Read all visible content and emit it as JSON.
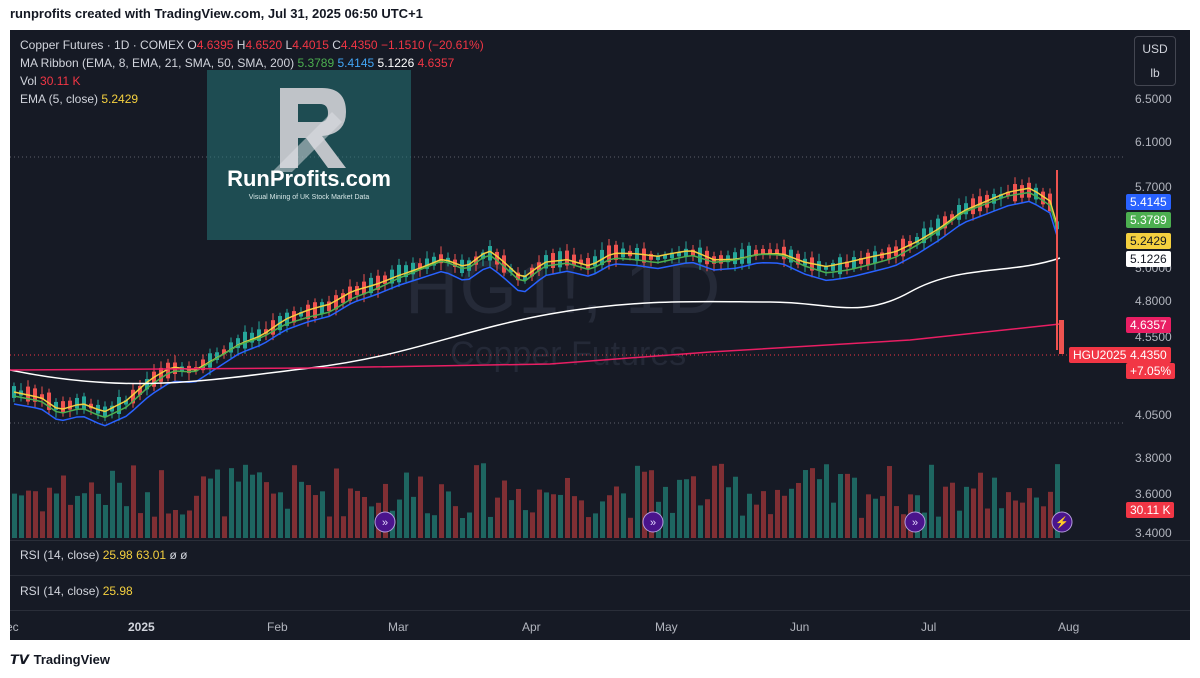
{
  "header": {
    "created_line": "runprofits created with TradingView.com, Jul 31, 2025 06:50 UTC+1"
  },
  "legend": {
    "symbol": "Copper Futures · 1D · COMEX",
    "o_label": "O",
    "o_value": "4.6395",
    "h_label": "H",
    "h_value": "4.6520",
    "l_label": "L",
    "l_value": "4.4015",
    "c_label": "C",
    "c_value": "4.4350",
    "change": "−1.1510 (−20.61%)",
    "ribbon_label": "MA Ribbon (EMA, 8, EMA, 21, SMA, 50, SMA, 200)",
    "ribbon_v1": "5.3789",
    "ribbon_v2": "5.4145",
    "ribbon_v3": "5.1226",
    "ribbon_v4": "4.6357",
    "vol_label": "Vol",
    "vol_value": "30.11 K",
    "ema_label": "EMA (5, close)",
    "ema_value": "5.2429"
  },
  "watermark": {
    "symbol": "HG1!, 1D",
    "name": "Copper Futures"
  },
  "logo": {
    "name": "RunProfits.com",
    "tagline": "Visual Mining of UK Stock Market Data"
  },
  "currency": {
    "code": "USD",
    "unit": "lb"
  },
  "price_axis": {
    "ticks": [
      "6.5000",
      "6.1000",
      "5.7000",
      "5.0000",
      "4.8000",
      "4.5500",
      "4.0500",
      "3.8000",
      "3.6000",
      "3.4000"
    ]
  },
  "price_tags": {
    "ema21": "5.4145",
    "ema8": "5.3789",
    "ema5": "5.2429",
    "sma50": "5.1226",
    "sma200": "4.6357",
    "contract": "HGU2025",
    "last": "4.4350",
    "change_pct": "+7.05%",
    "volume": "30.11 K"
  },
  "colors": {
    "up": "#26a69a",
    "down": "#ef5350",
    "ema5": "#f4d03f",
    "ema8": "#4caf50",
    "ema21": "#2962ff",
    "sma50": "#ffffff",
    "sma200": "#e91e63"
  },
  "rsi_panes": [
    {
      "label": "RSI (14, close)",
      "v1": "25.98",
      "v2": "63.01",
      "v3": "ø",
      "v4": "ø"
    },
    {
      "label": "RSI (14, close)",
      "v1": "25.98"
    }
  ],
  "time_axis": {
    "labels": [
      "ec",
      "2025",
      "Feb",
      "Mar",
      "Apr",
      "May",
      "Jun",
      "Jul",
      "Aug"
    ]
  },
  "footer": {
    "brand": "TradingView"
  },
  "icons": [
    "lightning-icon",
    "forward-icon",
    "tradingview-logo-icon"
  ]
}
